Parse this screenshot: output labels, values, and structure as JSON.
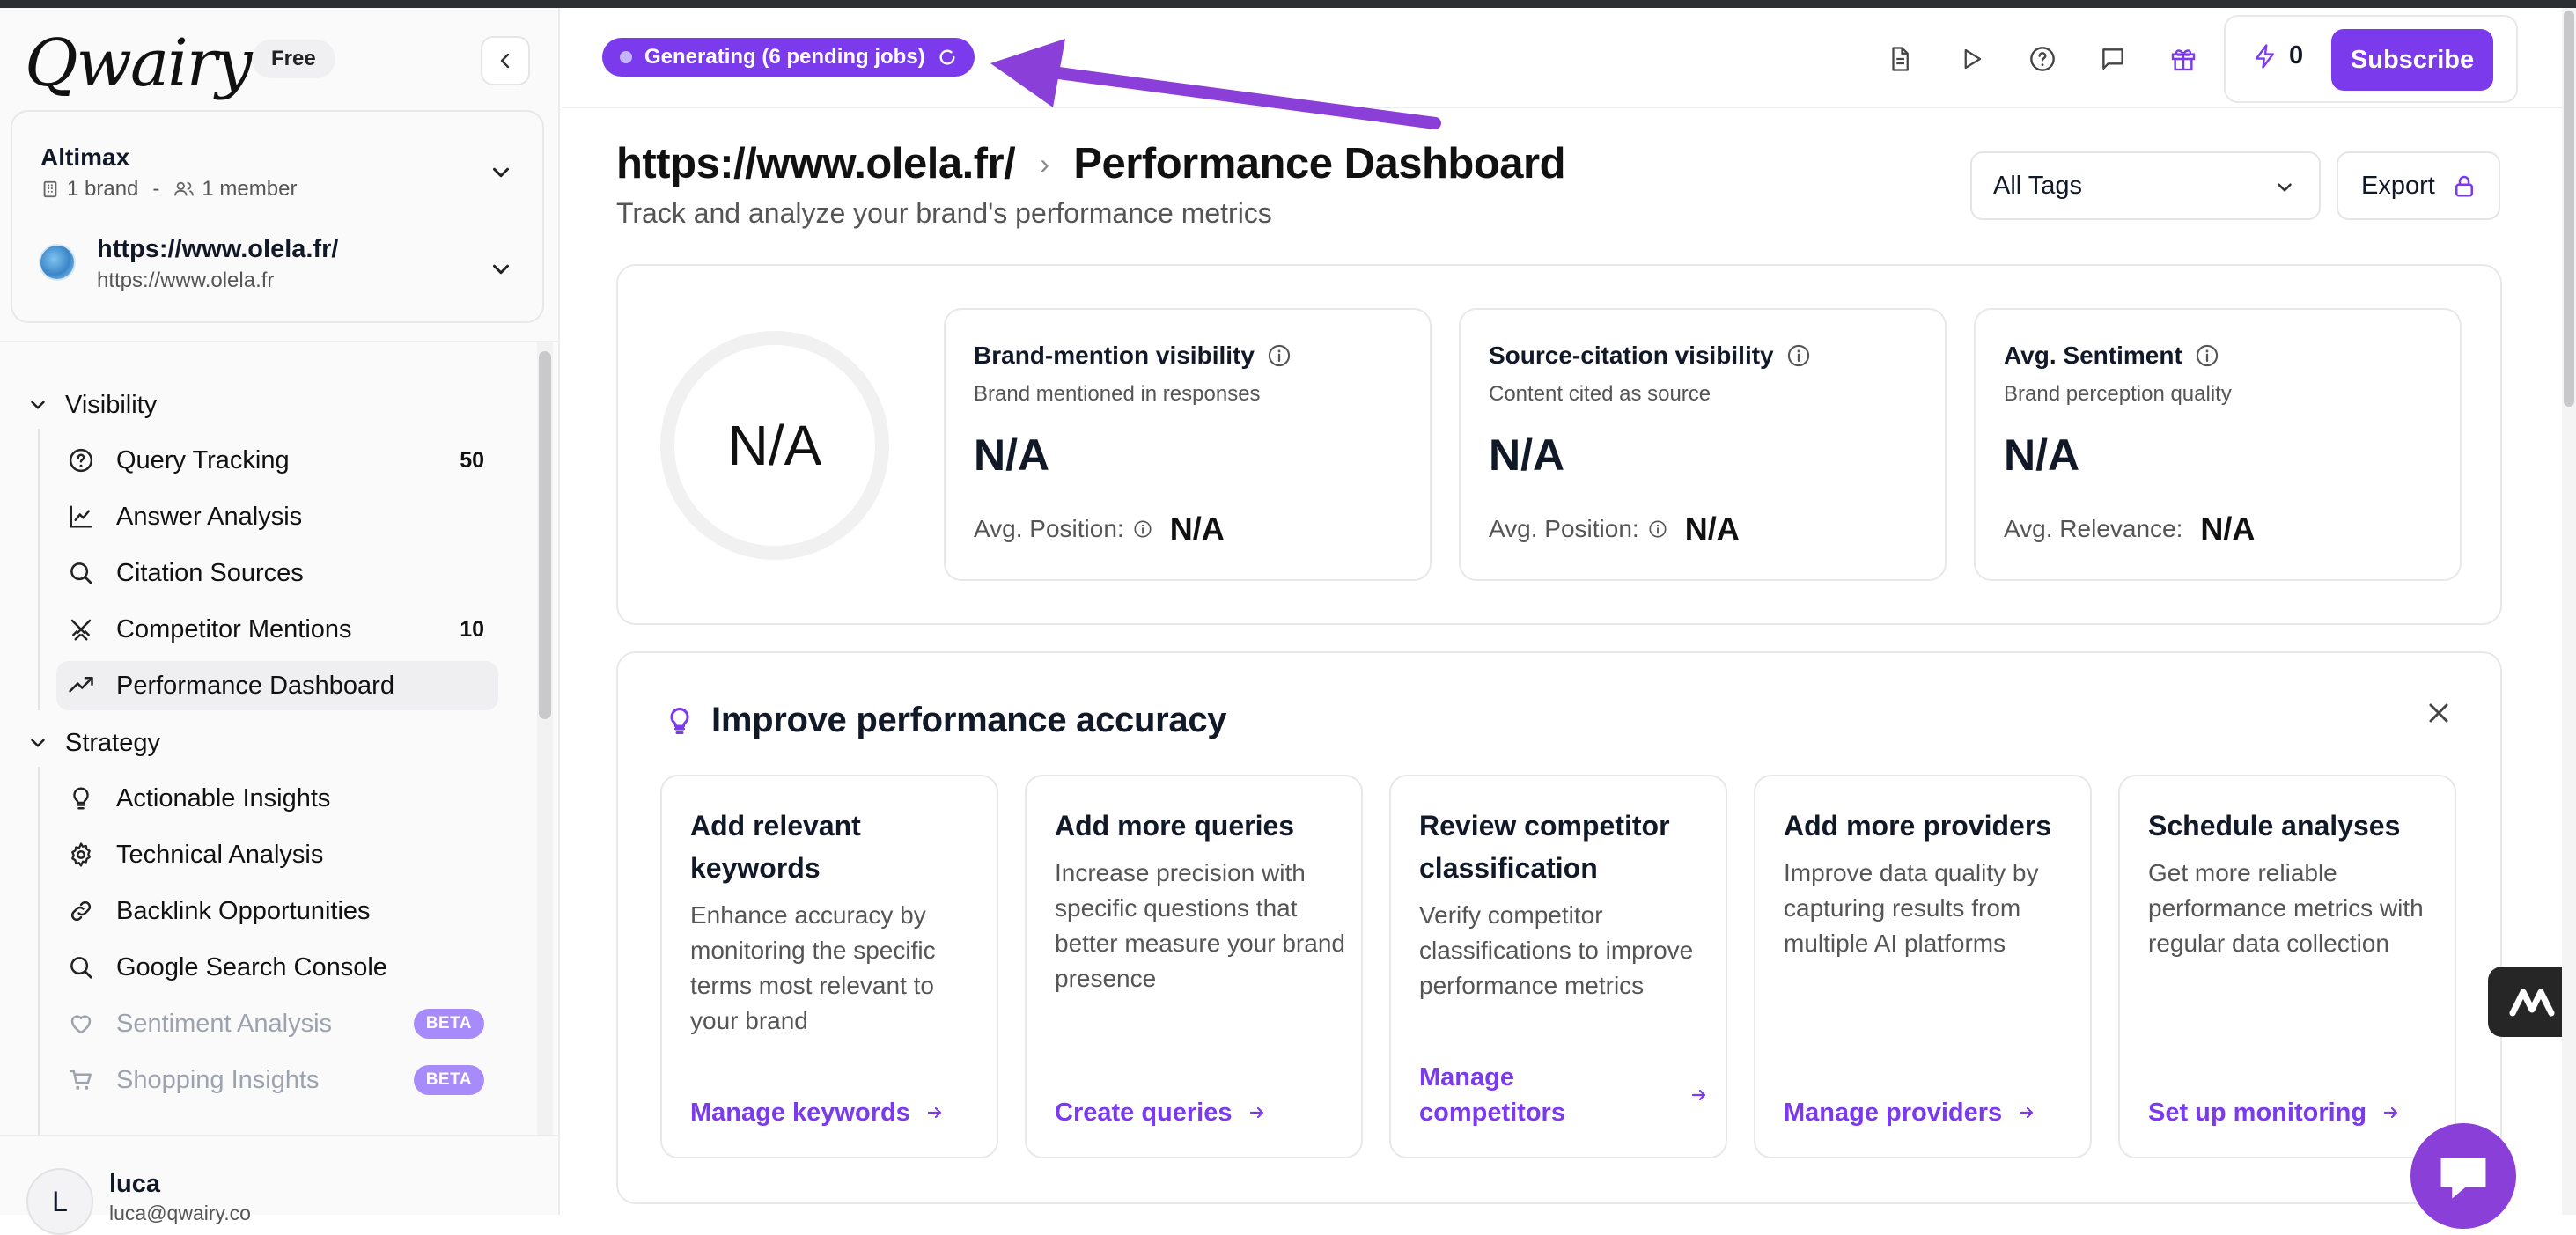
{
  "app": {
    "logo": "Qwairy",
    "plan": "Free"
  },
  "org": {
    "name": "Altimax",
    "brands": "1 brand",
    "separator": "-",
    "members": "1 member"
  },
  "site": {
    "title": "https://www.olela.fr/",
    "url": "https://www.olela.fr"
  },
  "sidebar": {
    "sections": [
      {
        "label": "Visibility",
        "items": [
          {
            "label": "Query Tracking",
            "icon": "help-circle-icon",
            "count": "50"
          },
          {
            "label": "Answer Analysis",
            "icon": "line-chart-icon"
          },
          {
            "label": "Citation Sources",
            "icon": "search-icon"
          },
          {
            "label": "Competitor Mentions",
            "icon": "crossed-swords-icon",
            "count": "10"
          },
          {
            "label": "Performance Dashboard",
            "icon": "trending-up-icon",
            "active": true
          }
        ]
      },
      {
        "label": "Strategy",
        "items": [
          {
            "label": "Actionable Insights",
            "icon": "lightbulb-icon"
          },
          {
            "label": "Technical Analysis",
            "icon": "gear-icon"
          },
          {
            "label": "Backlink Opportunities",
            "icon": "link-icon"
          },
          {
            "label": "Google Search Console",
            "icon": "search-icon"
          },
          {
            "label": "Sentiment Analysis",
            "icon": "heart-icon",
            "badge": "BETA",
            "disabled": true
          },
          {
            "label": "Shopping Insights",
            "icon": "cart-icon",
            "badge": "BETA",
            "disabled": true
          }
        ]
      }
    ]
  },
  "user": {
    "initial": "L",
    "name": "luca",
    "email": "luca@qwairy.co"
  },
  "header": {
    "status": "Generating (6 pending jobs)",
    "credits": "0",
    "subscribe": "Subscribe",
    "icons": [
      "document-icon",
      "play-icon",
      "help-icon",
      "chat-icon",
      "gift-icon"
    ]
  },
  "page": {
    "breadcrumb_site": "https://www.olela.fr/",
    "title": "Performance Dashboard",
    "subtitle": "Track and analyze your brand's performance metrics",
    "tags_filter": "All Tags",
    "export": "Export"
  },
  "score": "N/A",
  "metrics": [
    {
      "title": "Brand-mention visibility",
      "subtitle": "Brand mentioned in responses",
      "value": "N/A",
      "foot_label": "Avg. Position:",
      "foot_value": "N/A",
      "foot_info": true
    },
    {
      "title": "Source-citation visibility",
      "subtitle": "Content cited as source",
      "value": "N/A",
      "foot_label": "Avg. Position:",
      "foot_value": "N/A",
      "foot_info": true
    },
    {
      "title": "Avg. Sentiment",
      "subtitle": "Brand perception quality",
      "value": "N/A",
      "foot_label": "Avg. Relevance:",
      "foot_value": "N/A",
      "foot_info": false
    }
  ],
  "improve": {
    "title": "Improve performance accuracy",
    "cards": [
      {
        "title": "Add relevant keywords",
        "desc": "Enhance accuracy by monitoring the specific terms most relevant to your brand",
        "link": "Manage keywords"
      },
      {
        "title": "Add more queries",
        "desc": "Increase precision with specific questions that better measure your brand presence",
        "link": "Create queries"
      },
      {
        "title": "Review competitor classification",
        "desc": "Verify competitor classifications to improve performance metrics",
        "link": "Manage competitors"
      },
      {
        "title": "Add more providers",
        "desc": "Improve data quality by capturing results from multiple AI platforms",
        "link": "Manage providers"
      },
      {
        "title": "Schedule analyses",
        "desc": "Get more reliable performance metrics with regular data collection",
        "link": "Set up monitoring"
      }
    ]
  },
  "colors": {
    "accent": "#7c3aed",
    "arrow": "#8b3fd9",
    "beta": "#a78bfa"
  }
}
